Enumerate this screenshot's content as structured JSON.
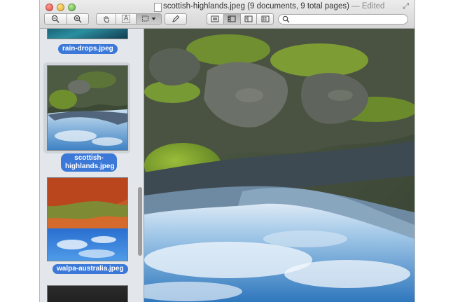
{
  "window": {
    "title": "scottish-highlands.jpeg (9 documents, 9 total pages)",
    "edited_suffix": "— Edited"
  },
  "toolbar": {
    "zoom_out_icon": "zoom-out-icon",
    "zoom_in_icon": "zoom-in-icon",
    "move_icon": "hand-icon",
    "text_tool_label": "A",
    "selection_icon": "rect-selection-icon",
    "edit_icon": "pencil-icon",
    "view_icons": [
      "content-only-icon",
      "thumbnails-icon",
      "table-of-contents-icon",
      "contact-sheet-icon"
    ],
    "active_view": 1,
    "search": {
      "value": "",
      "placeholder": ""
    }
  },
  "sidebar": {
    "items": [
      {
        "label": "rain-drops.jpeg",
        "selected": false
      },
      {
        "label": "scottish-highlands.jpeg",
        "selected": true
      },
      {
        "label": "walpa-australia.jpeg",
        "selected": false
      }
    ]
  },
  "colors": {
    "selection_accent": "#3b78d8",
    "sidebar_bg": "#e3e7ec"
  }
}
